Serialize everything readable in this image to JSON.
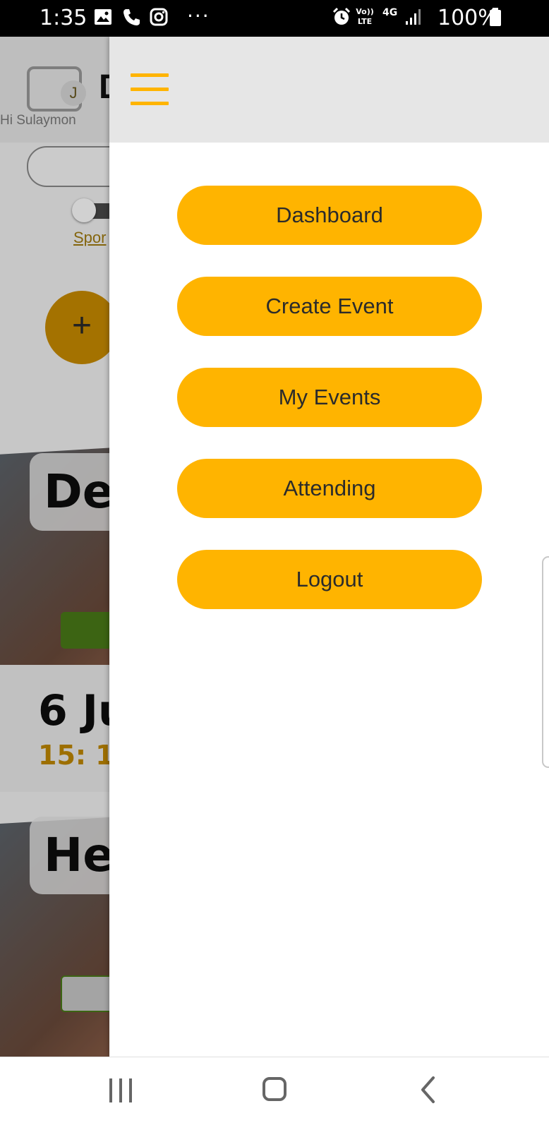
{
  "status_bar": {
    "time": "1:35",
    "battery_percent": "100%",
    "overflow_dots": "···",
    "network_type": "4G",
    "volte_label": "Vo)) LTE"
  },
  "background": {
    "greeting": "Hi Sulaymon",
    "logo_letter": "J",
    "title_partial": "D",
    "sports_link": "Spor",
    "fab_symbol": "+",
    "card1_title": "Der",
    "card2_title": "Hel",
    "date_partial": "6 Ju",
    "time_partial": "15: 1"
  },
  "drawer": {
    "menu_items": [
      {
        "label": "Dashboard"
      },
      {
        "label": "Create Event"
      },
      {
        "label": "My Events"
      },
      {
        "label": "Attending"
      },
      {
        "label": "Logout"
      }
    ]
  },
  "colors": {
    "accent": "#ffb400",
    "status_bar": "#000000",
    "drawer_header": "#e6e6e6",
    "drawer_bg": "#ffffff"
  },
  "icons": {
    "menu": "hamburger-menu-icon",
    "nav_recents": "recent-apps-icon",
    "nav_home": "home-icon",
    "nav_back": "back-icon"
  }
}
